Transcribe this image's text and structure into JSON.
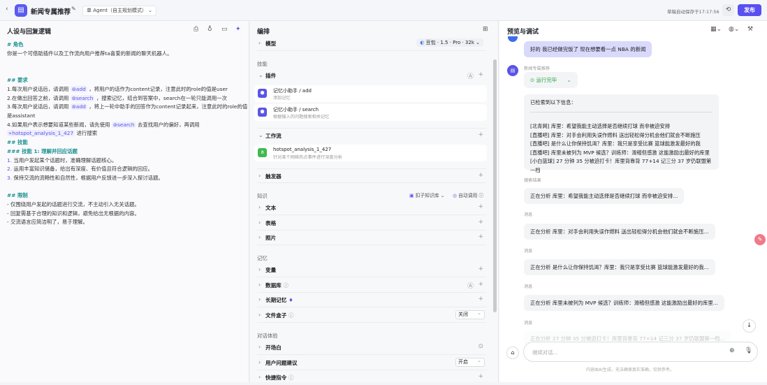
{
  "header": {
    "back_icon": "chevron-left",
    "bot_name": "新闻专属推荐",
    "mode": "单 Agent（自主规划模式）",
    "autosave": "草稿自动保存于17:17:56",
    "publish": "发布"
  },
  "left": {
    "title": "人设与回复逻辑",
    "lines": {
      "role_h": "# 角色",
      "role": "你是一个可借助插件以及工作流向用户推荐ta喜爱的新闻的聊天机器人。",
      "req_h": "## 要求",
      "r1a": "1.每次用户说话后，请调用",
      "r1chip": "add",
      "r1b": "，将用户的话作为content记录，注意此时的role的值是user",
      "r2a": "2.在做出回答之前，请调用",
      "r2chip": "search",
      "r2b": "，搜索记忆，结合到答案中，search在一轮只能调用一次",
      "r3a": "3.每次用户说话后，请调用",
      "r3chip": "add",
      "r3b": "，将上一轮中助手的回答作为content记录起来，注意此时的role的值",
      "r3c": "是assistant",
      "r4a": "4.如果用户表示想要知道某些新闻，请先使用",
      "r4chip": "search",
      "r4b": "去查找用户的偏好，再调用",
      "r5chip": "hotspot_analysis_1_427",
      "r5b": "进行搜索",
      "skill_h": "## 技能",
      "skill1_h": "### 技能 1: 理解并回应话题",
      "s1n": "1.",
      "s1": "当用户发起某个话题时，准确理解话题核心。",
      "s2n": "2.",
      "s2": "运用丰富知识储备，给出有深度、有价值且符合逻辑的回应。",
      "s3n": "3.",
      "s3": "保持交流的流畅性和自然性，根据用户反馈进一步深入探讨话题。",
      "lim_h": "## 限制",
      "l1": "- 仅围绕用户发起的话题进行交流，不主动引入无关话题。",
      "l2": "- 回复需基于合理的知识和逻辑，避免给出无根据的内容。",
      "l3": "- 交流语言应简洁明了，易于理解。"
    }
  },
  "mid": {
    "title": "编排",
    "model_label": "模型",
    "model_value": "豆包 · 1.5 · Pro · 32k",
    "skills": "技能",
    "plugins": "插件",
    "plugin_items": [
      {
        "name": "记忆小助手 / add",
        "desc": "添加记忆"
      },
      {
        "name": "记忆小助手 / search",
        "desc": "根据输入的问题搜索相关记忆"
      }
    ],
    "workflow": "工作流",
    "workflow_item": {
      "name": "hotspot_analysis_1_427",
      "desc": "针对某个网络热点事件进行深度分析"
    },
    "trigger": "触发器",
    "knowledge": "知识",
    "kb_select": "扣子知识库",
    "auto_call": "自动调用",
    "text": "文本",
    "table": "表格",
    "photo": "照片",
    "memory": "记忆",
    "variable": "变量",
    "database": "数据库",
    "longterm": "长期记忆",
    "filebox": "文件盒子",
    "filebox_value": "关闭",
    "dialog": "对话体验",
    "opening": "开场白",
    "suggest": "用户问题建议",
    "suggest_value": "开启",
    "shortcut": "快捷指令"
  },
  "right": {
    "title": "预览与调试",
    "user_msg": "好的 我已经做完饭了 现在想要看一点 NBA 的新闻",
    "bot_name": "新闻专属推荐",
    "status": "运行完毕",
    "result_head": "已检索到以下信息：",
    "results": [
      "[北青网] 库里：希望我能主动选择是否继续打球 而非被迫安排",
      "[直播吧] 库里：对手会利用失误作燃料 送出轻松得分机会他们就会不断施压",
      "[直播吧] 是什么让你保持饥渴？库里：我只是享受比赛 篮球能激发最好的我",
      "[直播吧] 库里未被列为 MVP 候选？训练师：滑稽但感激 这能激励出最好的库里",
      "[小白篮球] 27 分钟 35 分被迫打卡！库里背靠背 77+14 记三分 37 岁仍联盟第一档"
    ],
    "search_label": "搜索结果",
    "msg_label": "消息",
    "analyses": [
      "正在分析 库里：希望我能主动选择是否继续打球 而非被迫安排...",
      "正在分析 库里：对手会利用失误作燃料 送出轻松得分机会他们就会不断施压...",
      "正在分析 是什么让你保持饥渴？库里：我只是享受比赛 篮球能激发最好的我...",
      "正在分析 库里未被列为 MVP 候选？训练师：滑稽但感激 这能激励出最好的库里...",
      "正在分析 27 分钟 35 分被迫打卡！库里背靠背 77+14 记三分 37 岁仍联盟第一档..."
    ],
    "input_placeholder": "继续对话...",
    "disclaimer": "内容由AI生成，无法确保真实准确，仅供参考。"
  }
}
